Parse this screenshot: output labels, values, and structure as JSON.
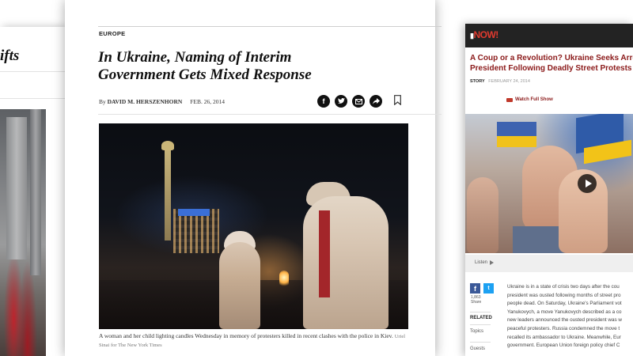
{
  "left_article": {
    "headline_fragment": "ifts"
  },
  "center_article": {
    "section": "EUROPE",
    "headline_line1": "In Ukraine, Naming of Interim",
    "headline_line2": "Government Gets Mixed Response",
    "byline_prefix": "By",
    "author": "DAVID M. HERSZENHORN",
    "date": "FEB. 26, 2014",
    "share_icons": [
      "facebook-icon",
      "twitter-icon",
      "email-icon",
      "share-icon"
    ],
    "caption_text": "A woman and her child lighting candles Wednesday in memory of protesters killed in recent clashes with the police in Kiev.",
    "caption_credit": "Uriel Sinai for The New York Times"
  },
  "right_article": {
    "logo_text": "NOW!",
    "title_line1": "A Coup or a Revolution? Ukraine Seeks Arres",
    "title_line2": "President Following Deadly Street Protests",
    "meta_label": "STORY",
    "meta_date": "FEBRUARY 24, 2014",
    "watch_label": "Watch Full Show",
    "listen_label": "Listen",
    "share_count_line1": "1,863",
    "share_count_line2": "Share",
    "side_labels": [
      "RELATED",
      "Topics",
      "Guests"
    ],
    "body_lines": [
      "Ukraine is in a state of crisis two days after the cou",
      "president was ousted following months of street pro",
      "people dead. On Saturday, Ukraine's Parliament vot",
      "Yanukovych, a move Yanukovych described as a co",
      "new leaders announced the ousted president was w",
      "peaceful protesters. Russia condemned the move t",
      "recalled its ambassador to Ukraine. Meanwhile, Eur",
      "government. European Union foreign policy chief C"
    ]
  },
  "colors": {
    "dn_red": "#8b1a1a",
    "dn_header": "#232323",
    "facebook": "#3b5998",
    "twitter": "#1da1f2"
  }
}
